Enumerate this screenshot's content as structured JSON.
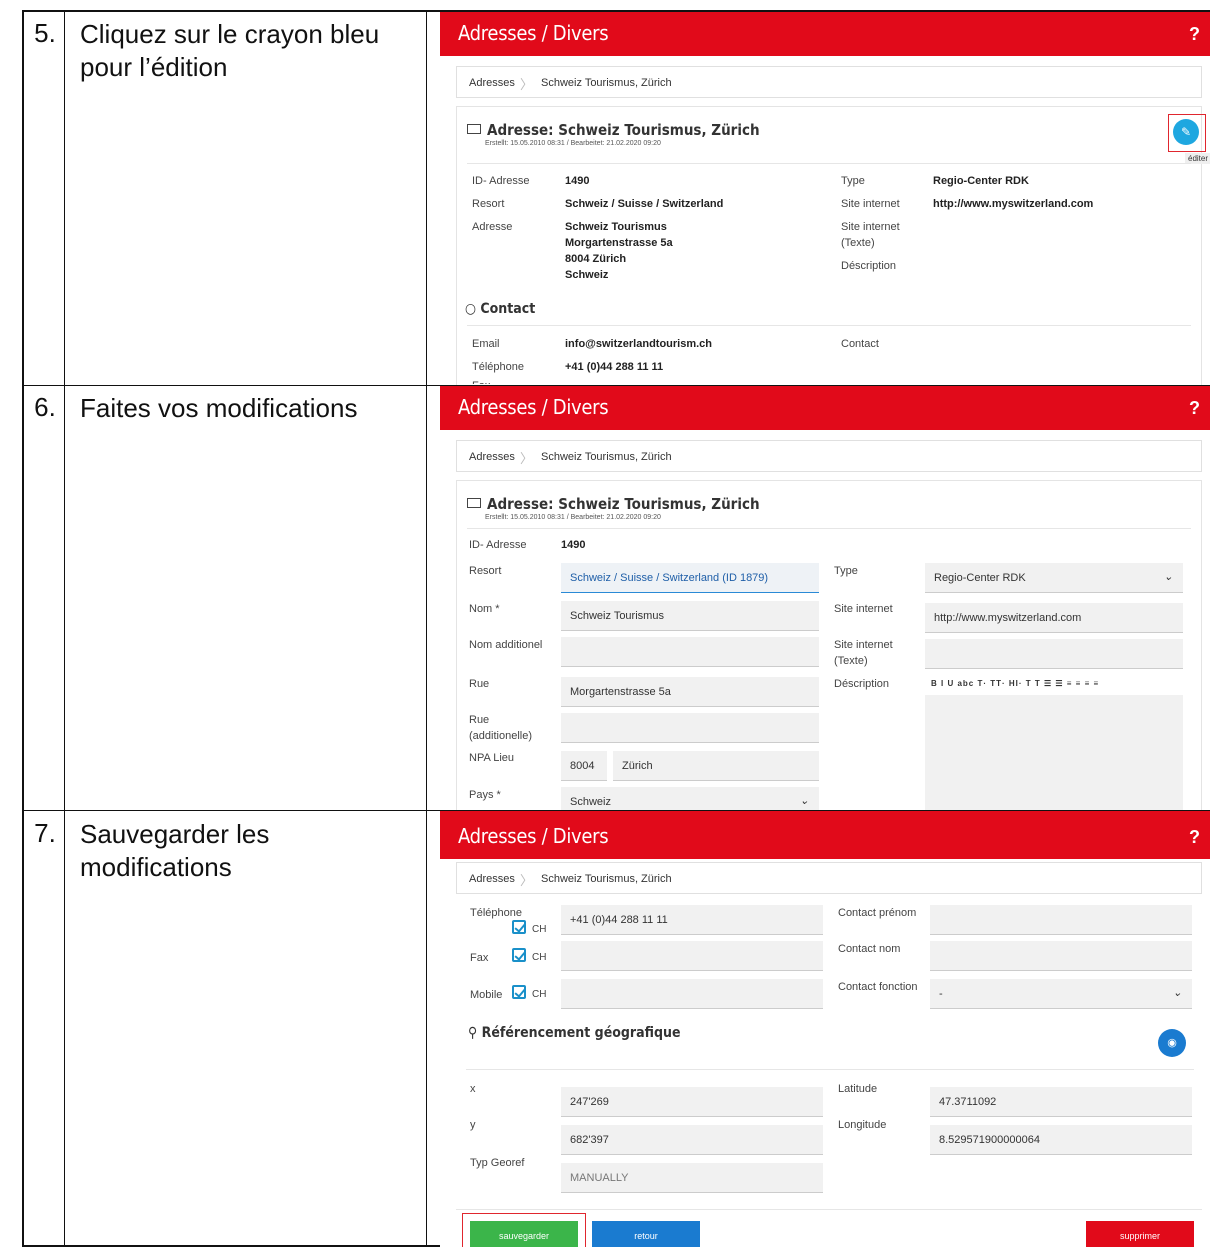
{
  "steps": [
    {
      "num": "5.",
      "text": "Cliquez sur le crayon bleu pour l’édition"
    },
    {
      "num": "6.",
      "text": "Faites vos modifications"
    },
    {
      "num": "7.",
      "text": "Sauvegarder les modifications"
    }
  ],
  "app": {
    "title": "Adresses / Divers",
    "help": "?",
    "breadcrumb_root": "Adresses",
    "breadcrumb_sep": "〉",
    "breadcrumb_current": "Schweiz Tourismus, Zürich"
  },
  "panel5": {
    "card_title": "Adresse: Schweiz Tourismus, Zürich",
    "card_meta": "Erstellt: 15.05.2010 08:31 / Bearbeitet: 21.02.2020 09:20",
    "edit_tooltip": "éditer",
    "labels": {
      "id": "ID- Adresse",
      "resort": "Resort",
      "adresse": "Adresse",
      "type": "Type",
      "site": "Site internet",
      "site_text": "Site internet (Texte)",
      "description": "Déscription",
      "email": "Email",
      "telephone": "Téléphone",
      "contact": "Contact",
      "fax": "Fax"
    },
    "values": {
      "id": "1490",
      "resort": "Schweiz / Suisse / Switzerland",
      "adresse_1": "Schweiz Tourismus",
      "adresse_2": "Morgartenstrasse 5a",
      "adresse_3": "8004 Zürich",
      "adresse_4": "Schweiz",
      "type": "Regio-Center RDK",
      "site": "http://www.myswitzerland.com",
      "email": "info@switzerlandtourism.ch",
      "telephone": "+41 (0)44 288 11 11"
    },
    "contact_section": "Contact"
  },
  "panel6": {
    "card_title": "Adresse: Schweiz Tourismus, Zürich",
    "card_meta": "Erstellt: 15.05.2010 08:31 / Bearbeitet: 21.02.2020 09:20",
    "labels": {
      "id": "ID- Adresse",
      "resort": "Resort",
      "nom": "Nom *",
      "nom_add": "Nom additionel",
      "rue": "Rue",
      "rue_add": "Rue (additionelle)",
      "npa": "NPA Lieu",
      "pays": "Pays *",
      "type": "Type",
      "site": "Site internet",
      "site_text": "Site internet (Texte)",
      "description": "Déscription"
    },
    "values": {
      "id": "1490",
      "resort": "Schweiz / Suisse / Switzerland (ID 1879)",
      "nom": "Schweiz Tourismus",
      "nom_add": "",
      "rue": "Morgartenstrasse 5a",
      "rue_add": "",
      "npa": "8004",
      "lieu": "Zürich",
      "pays": "Schweiz",
      "type": "Regio-Center RDK",
      "site": "http://www.myswitzerland.com",
      "site_text": ""
    },
    "editor_toolbar": "B I U abc T· TT· HI· T T ☰ ☰ ≡ ≡ ≡ ≡"
  },
  "panel7": {
    "labels": {
      "telephone": "Téléphone",
      "fax": "Fax",
      "mobile": "Mobile",
      "ch": "CH",
      "contact_prenom": "Contact prénom",
      "contact_nom": "Contact nom",
      "contact_fonction": "Contact fonction",
      "x": "x",
      "y": "y",
      "typ_georef": "Typ Georef",
      "latitude": "Latitude",
      "longitude": "Longitude"
    },
    "values": {
      "telephone": "+41 (0)44 288 11 11",
      "fax": "",
      "mobile": "",
      "contact_fonction": "-",
      "x": "247'269",
      "y": "682'397",
      "typ_georef": "MANUALLY",
      "latitude": "47.3711092",
      "longitude": "8.529571900000064"
    },
    "georef_section": "Référencement géografique",
    "buttons": {
      "save": "sauvegarder",
      "back": "retour",
      "delete": "supprimer"
    }
  },
  "colors": {
    "brand_red": "#e10a1a",
    "edit_blue": "#1ea7e0",
    "save_green": "#3bb54a",
    "back_blue": "#1a7bd0",
    "highlight_red": "#e0262e"
  },
  "icons": {
    "edit": "pencil-icon",
    "mail": "envelope-icon",
    "chat": "speech-bubble-icon",
    "map_pin": "map-pin-icon",
    "chevron": "chevron-down-icon"
  }
}
